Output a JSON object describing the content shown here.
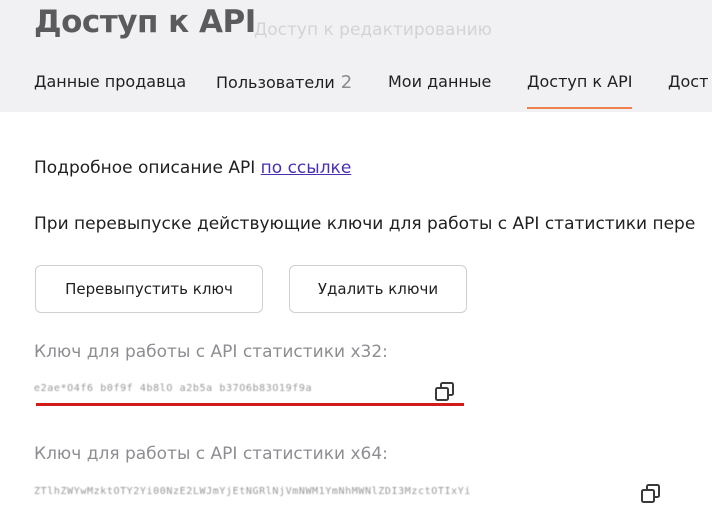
{
  "header": {
    "title": "Доступ к API",
    "subtitle": "Доступ к редактированию"
  },
  "tabs": [
    {
      "label": "Данные продавца"
    },
    {
      "label": "Пользователи",
      "count": "2"
    },
    {
      "label": "Мои данные"
    },
    {
      "label": "Доступ к API",
      "active": true
    },
    {
      "label": "Дост"
    }
  ],
  "main": {
    "description_prefix": "Подробное описание API",
    "description_link": "по ссылке",
    "warning_text": "При перевыпуске действующие ключи для работы с API статистики пере",
    "reissue_button": "Перевыпустить ключ",
    "delete_button": "Удалить ключи",
    "key32": {
      "label": "Ключ для работы с API статистики x32:",
      "value": "e2ae*O4f6 b0f9f 4b8lO a2b5a b37O6b83O19f9a"
    },
    "key64": {
      "label": "Ключ для работы с API статистики x64:",
      "value": "ZTlhZWYwMzktOTY2Yi00NzE2LWJmYjEtNGRlNjVmNWM1YmNhMWNlZDI3MzctOTIxYi"
    }
  },
  "colors": {
    "accent": "#f07f4c",
    "link": "#4a2fb3",
    "highlight_line": "#d11b1b"
  },
  "icons": {
    "copy": "copy-icon"
  }
}
